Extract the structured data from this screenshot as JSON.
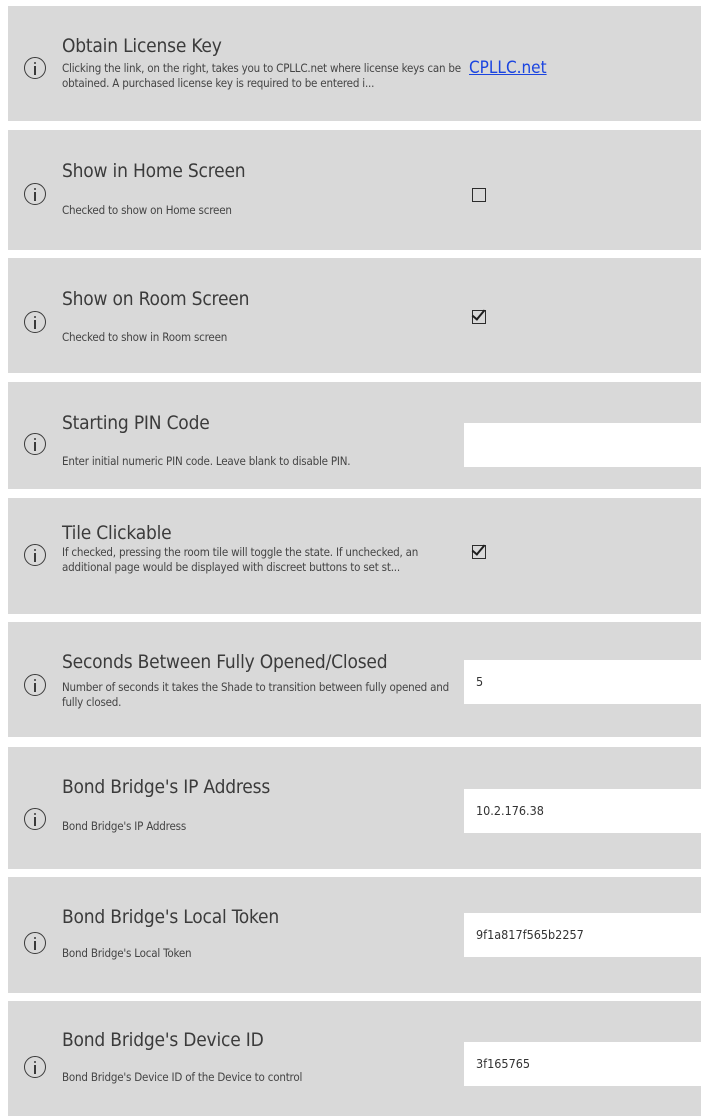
{
  "settings": [
    {
      "title": "Obtain License Key",
      "description": "Clicking the link, on the right, takes you to CPLLC.net where license keys can be obtained.  A purchased license key is required to be entered i...",
      "control": "link",
      "link_text": "CPLLC.net"
    },
    {
      "title": "Show in Home Screen",
      "description": "Checked to show on Home screen",
      "control": "checkbox",
      "checked": false
    },
    {
      "title": "Show on Room Screen",
      "description": "Checked to show in Room screen",
      "control": "checkbox",
      "checked": true
    },
    {
      "title": "Starting PIN Code",
      "description": "Enter initial numeric PIN code.  Leave blank to disable PIN.",
      "control": "text",
      "value": ""
    },
    {
      "title": "Tile Clickable",
      "description": "If checked, pressing the room tile will toggle the state.  If unchecked, an additional page would  be displayed with discreet buttons to set st...",
      "control": "checkbox",
      "checked": true
    },
    {
      "title": "Seconds Between Fully Opened/Closed",
      "description": "Number of seconds it takes the Shade to transition between fully opened and fully closed.",
      "control": "text",
      "value": "5"
    },
    {
      "title": "Bond Bridge's IP Address",
      "description": "Bond Bridge's IP Address",
      "control": "text",
      "value": "10.2.176.38"
    },
    {
      "title": "Bond Bridge's Local Token",
      "description": "Bond Bridge's Local Token",
      "control": "text",
      "value": "9f1a817f565b2257"
    },
    {
      "title": "Bond Bridge's Device ID",
      "description": "Bond Bridge's Device ID of the Device to control",
      "control": "text",
      "value": "3f165765"
    }
  ],
  "icons": {
    "info": "info-circle-icon"
  },
  "colors": {
    "row_background": "#d9d9d9",
    "link": "#1a44e0",
    "field_background": "#ffffff"
  }
}
